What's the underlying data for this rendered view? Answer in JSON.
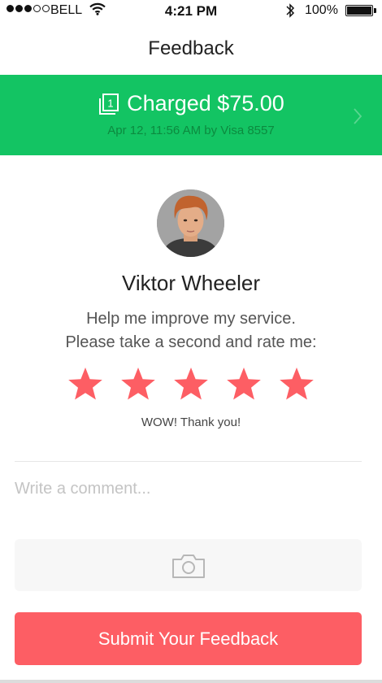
{
  "status_bar": {
    "signal_filled": 3,
    "signal_total": 5,
    "carrier": "BELL",
    "time": "4:21 PM",
    "battery_percent_text": "100%",
    "battery_level": 1.0
  },
  "nav": {
    "title": "Feedback"
  },
  "charge": {
    "title": "Charged $75.00",
    "subtitle": "Apr 12, 11:56 AM by Visa 8557",
    "receipt_icon_label": "1",
    "background_color": "#13c463"
  },
  "profile": {
    "name": "Viktor Wheeler",
    "prompt_line1": "Help me improve my service.",
    "prompt_line2": "Please take a second and rate me:"
  },
  "rating": {
    "value": 5,
    "max": 5,
    "star_color": "#fd5e64",
    "message": "WOW! Thank you!"
  },
  "comment": {
    "placeholder": "Write a comment...",
    "value": ""
  },
  "photo": {
    "icon": "camera-icon"
  },
  "submit": {
    "label": "Submit Your Feedback",
    "color": "#fd5e64"
  }
}
